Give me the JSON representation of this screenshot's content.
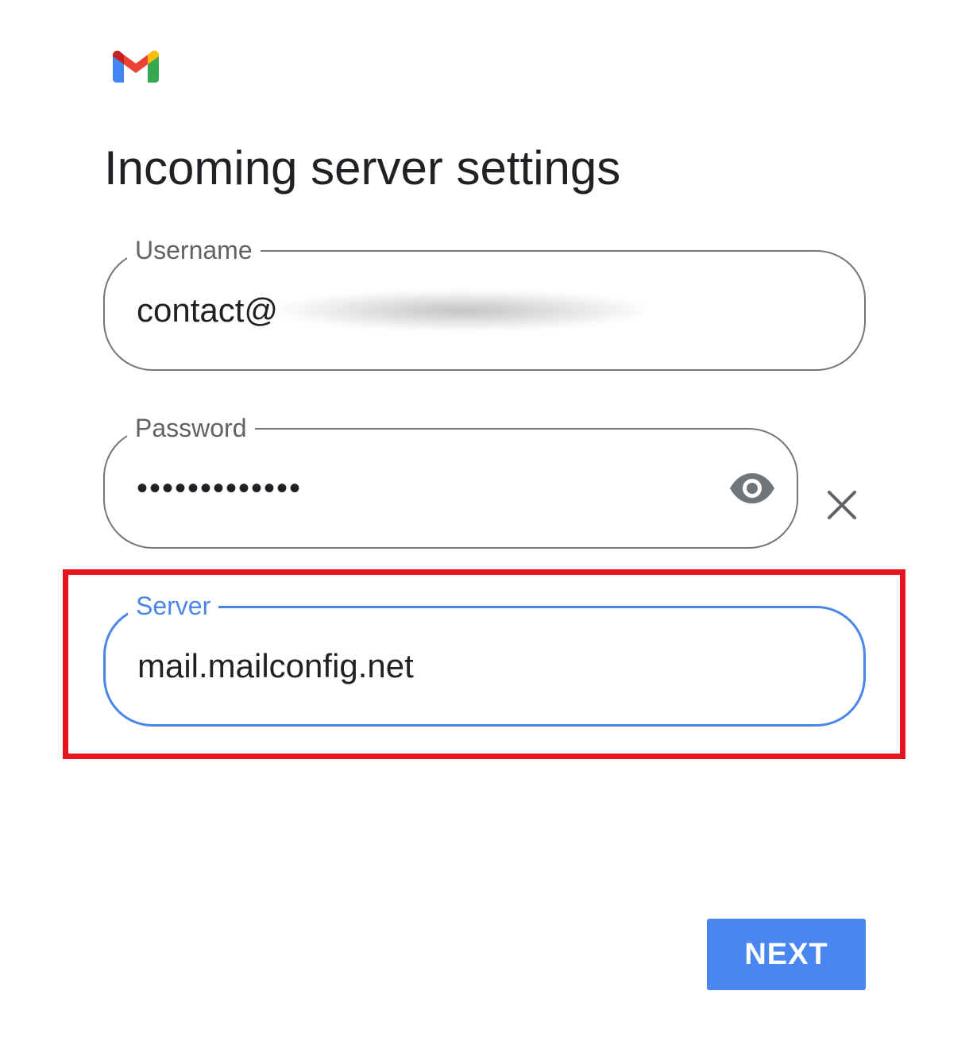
{
  "header": {
    "logo_icon": "gmail-logo-icon",
    "title": "Incoming server settings"
  },
  "form": {
    "username": {
      "label": "Username",
      "value_visible": "contact@"
    },
    "password": {
      "label": "Password",
      "value": "•••••••••••••",
      "toggle_icon": "eye-icon"
    },
    "clear_icon": "close-icon",
    "server": {
      "label": "Server",
      "value": "mail.mailconfig.net"
    }
  },
  "footer": {
    "next_label": "NEXT"
  },
  "colors": {
    "accent": "#4a86f2",
    "focus_border": "#4a86e8",
    "highlight": "#e6141e",
    "outline": "#747775"
  }
}
